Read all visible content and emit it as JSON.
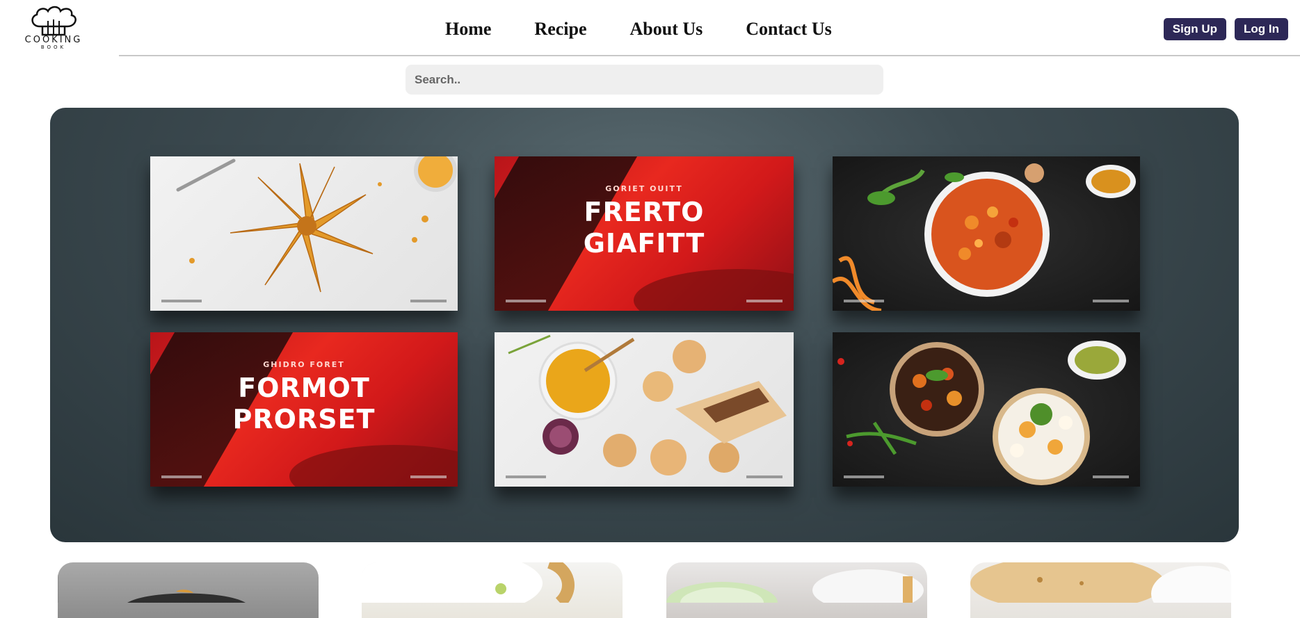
{
  "brand": {
    "name": "COOKING",
    "sub": "BOOK"
  },
  "nav": {
    "items": [
      {
        "label": "Home"
      },
      {
        "label": "Recipe"
      },
      {
        "label": "About Us"
      },
      {
        "label": "Contact Us"
      }
    ]
  },
  "auth": {
    "signup_label": "Sign Up",
    "login_label": "Log In"
  },
  "search": {
    "placeholder": "Search..",
    "value": ""
  },
  "hero": {
    "cards": [
      {
        "name": "star-pastry",
        "style": "light"
      },
      {
        "name": "red-poster-1",
        "style": "red",
        "subtitle": "GORIET OUITT",
        "title_line1": "FRERTO",
        "title_line2": "GIAFITT"
      },
      {
        "name": "curry-bowl",
        "style": "dark"
      },
      {
        "name": "red-poster-2",
        "style": "red",
        "subtitle": "GHIDRO FORET",
        "title_line1": "FORMOT",
        "title_line2": "PRORSET"
      },
      {
        "name": "soup-bread",
        "style": "light"
      },
      {
        "name": "veg-plates",
        "style": "dark"
      }
    ]
  },
  "colors": {
    "button_bg": "#2d2857",
    "hero_bg": "#2f3c41",
    "poster_red": "#e8281f"
  }
}
